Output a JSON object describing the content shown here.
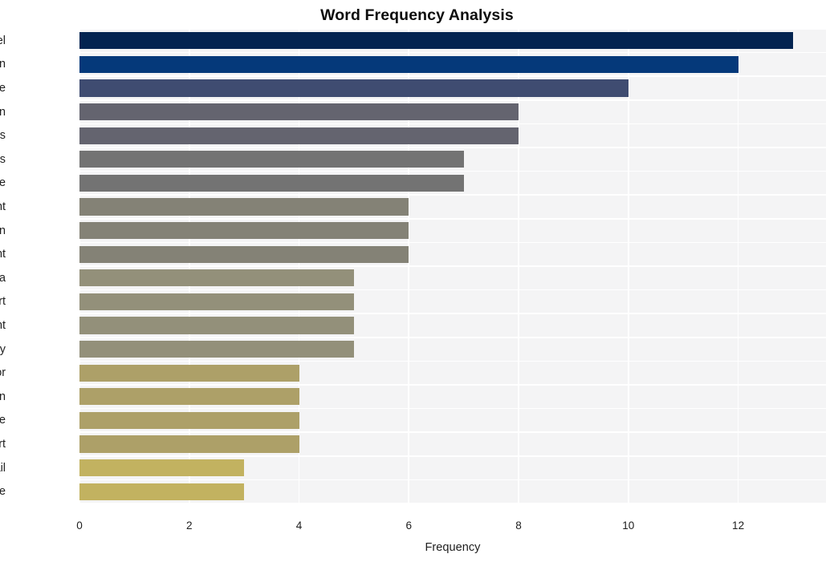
{
  "chart_data": {
    "type": "bar",
    "orientation": "horizontal",
    "title": "Word Frequency Analysis",
    "xlabel": "Frequency",
    "ylabel": "",
    "xlim": [
      0,
      13.6
    ],
    "xticks": [
      0,
      2,
      4,
      6,
      8,
      10,
      12
    ],
    "xtick_labels": [
      "0",
      "2",
      "4",
      "6",
      "8",
      "10",
      "12"
    ],
    "grid": true,
    "legend": null,
    "categories": [
      "israel",
      "resolution",
      "vote",
      "sen",
      "senators",
      "sanders",
      "state",
      "department",
      "human",
      "right",
      "gaza",
      "support",
      "oversight",
      "military",
      "floor",
      "sign",
      "include",
      "report",
      "fail",
      "time"
    ],
    "values": [
      13,
      12,
      10,
      8,
      8,
      7,
      7,
      6,
      6,
      6,
      5,
      5,
      5,
      5,
      4,
      4,
      4,
      4,
      3,
      3
    ],
    "bar_colors": [
      "#042451",
      "#05397a",
      "#3f4c71",
      "#64646f",
      "#64646f",
      "#737373",
      "#737373",
      "#848276",
      "#848276",
      "#848276",
      "#93907a",
      "#93907a",
      "#93907a",
      "#93907a",
      "#ada068",
      "#ada068",
      "#ada068",
      "#ada068",
      "#c2b260",
      "#c2b260"
    ],
    "bars": [
      {
        "label": "israel",
        "value": 13,
        "color": "#042451"
      },
      {
        "label": "resolution",
        "value": 12,
        "color": "#05397a"
      },
      {
        "label": "vote",
        "value": 10,
        "color": "#3f4c71"
      },
      {
        "label": "sen",
        "value": 8,
        "color": "#64646f"
      },
      {
        "label": "senators",
        "value": 8,
        "color": "#64646f"
      },
      {
        "label": "sanders",
        "value": 7,
        "color": "#737373"
      },
      {
        "label": "state",
        "value": 7,
        "color": "#737373"
      },
      {
        "label": "department",
        "value": 6,
        "color": "#848276"
      },
      {
        "label": "human",
        "value": 6,
        "color": "#848276"
      },
      {
        "label": "right",
        "value": 6,
        "color": "#848276"
      },
      {
        "label": "gaza",
        "value": 5,
        "color": "#93907a"
      },
      {
        "label": "support",
        "value": 5,
        "color": "#93907a"
      },
      {
        "label": "oversight",
        "value": 5,
        "color": "#93907a"
      },
      {
        "label": "military",
        "value": 5,
        "color": "#93907a"
      },
      {
        "label": "floor",
        "value": 4,
        "color": "#ada068"
      },
      {
        "label": "sign",
        "value": 4,
        "color": "#ada068"
      },
      {
        "label": "include",
        "value": 4,
        "color": "#ada068"
      },
      {
        "label": "report",
        "value": 4,
        "color": "#ada068"
      },
      {
        "label": "fail",
        "value": 3,
        "color": "#c2b260"
      },
      {
        "label": "time",
        "value": 3,
        "color": "#c2b260"
      }
    ],
    "style": {
      "plot_background": "#f4f4f5",
      "figure_background": "#ffffff",
      "gridline_color": "#ffffff",
      "text_color": "#1f1f1f",
      "title_color": "#0d0d0d"
    }
  }
}
